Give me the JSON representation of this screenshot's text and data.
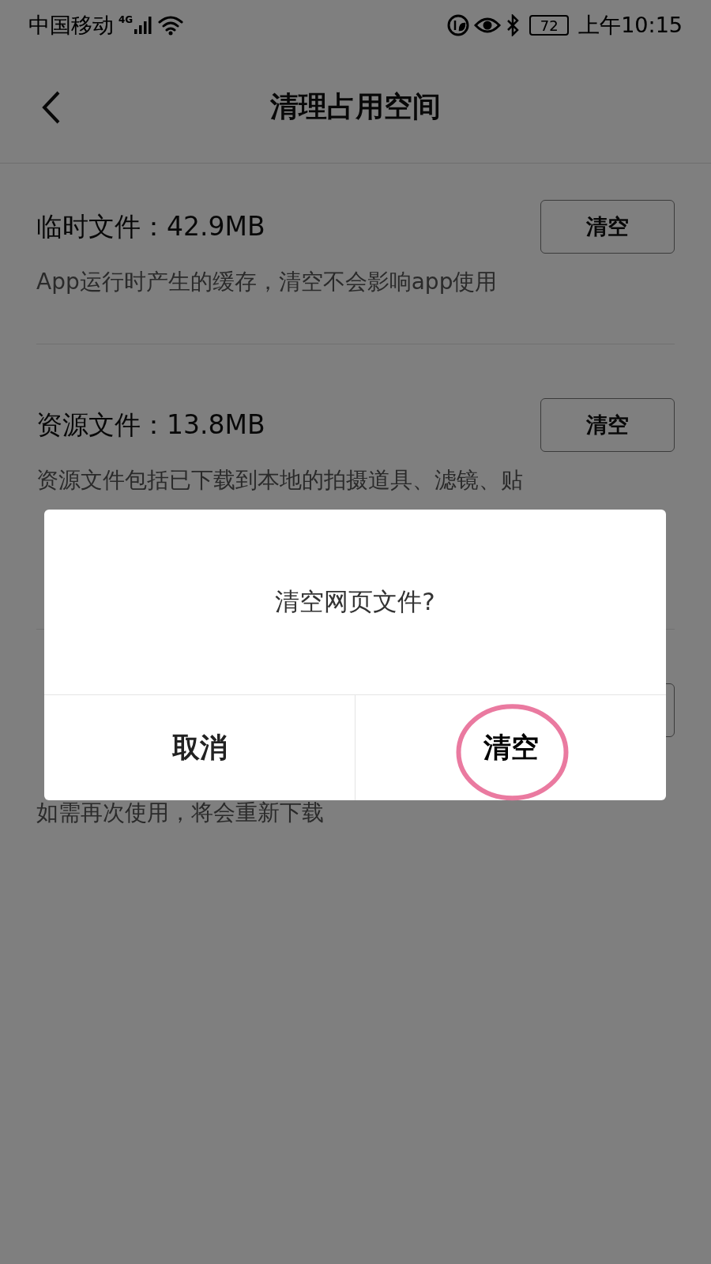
{
  "status_bar": {
    "carrier": "中国移动",
    "network": "4G",
    "battery": "72",
    "time": "上午10:15"
  },
  "header": {
    "title": "清理占用空间"
  },
  "sections": [
    {
      "kind": "full",
      "title": "临时文件：42.9MB",
      "button": "清空",
      "description": "App运行时产生的缓存，清空不会影响app使用"
    },
    {
      "kind": "partly_covered",
      "title": "资源文件：13.8MB",
      "button": "清空",
      "description": "资源文件包括已下载到本地的拍摄道具、滤镜、贴"
    },
    {
      "kind": "covered",
      "description": "如需再次使用，将会重新下载"
    }
  ],
  "dialog": {
    "message": "清空网页文件?",
    "buttons": [
      {
        "kind": "cancel",
        "label": "取消",
        "highlighted": false
      },
      {
        "kind": "confirm",
        "label": "清空",
        "highlighted": true
      }
    ]
  }
}
